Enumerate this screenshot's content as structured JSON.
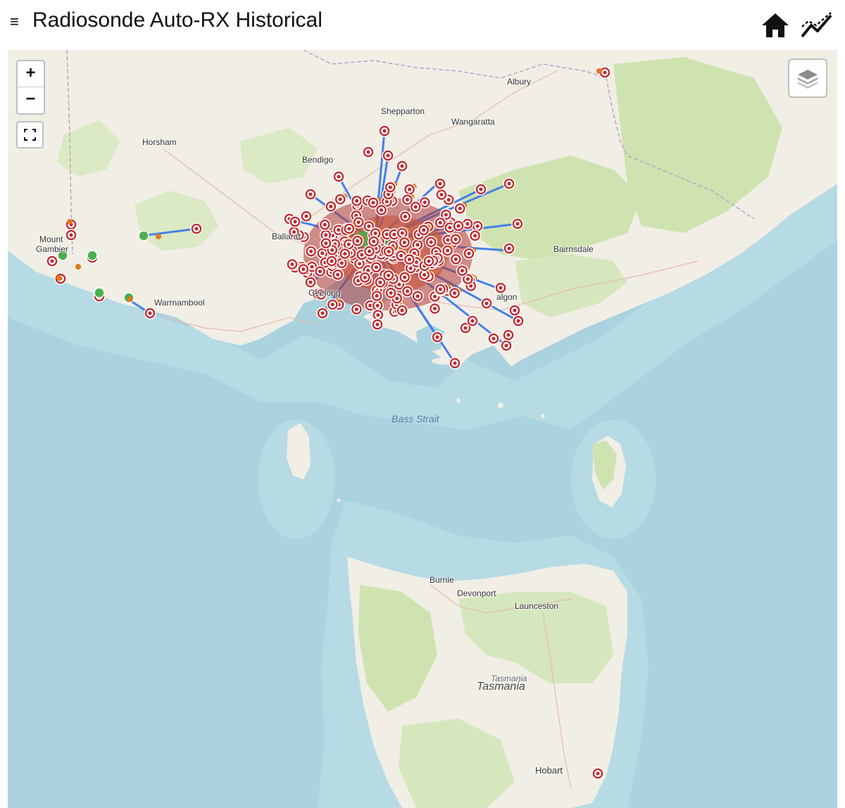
{
  "header": {
    "title": "Radiosonde Auto-RX Historical",
    "menu_glyph": "≡",
    "home_icon": "home-icon",
    "chart_icon": "line-chart-icon"
  },
  "controls": {
    "zoom_in": "+",
    "zoom_out": "−",
    "fullscreen_icon": "fullscreen-icon",
    "layers_icon": "layers-icon"
  },
  "map": {
    "cities": {
      "albury": "Albury",
      "shepparton": "Shepparton",
      "wangaratta": "Wangaratta",
      "horsham": "Horsham",
      "bendigo": "Bendigo",
      "ballarat": "Ballarat",
      "mount": "Mount",
      "gambier": "Gambier",
      "bairnsdale": "Bairnsdale",
      "warrnambool": "Warrnambool",
      "geelong": "Geelong",
      "traralgon": "algon",
      "burnie": "Burnie",
      "devonport": "Devonport",
      "launceston": "Launceston",
      "hobart": "Hobart"
    },
    "sea": {
      "bass_strait": "Bass Strait"
    },
    "region": {
      "tasmania_small": "Tasmania",
      "tasmania": "Tasmania"
    },
    "colors": {
      "water": "#aad3df",
      "land": "#f1eee6",
      "forest": "#cfe3b0",
      "track": "#3d7be8",
      "landing_marker": "#c0282d",
      "burst_marker": "#e07a1c",
      "launch_marker": "#4caf50"
    }
  }
}
